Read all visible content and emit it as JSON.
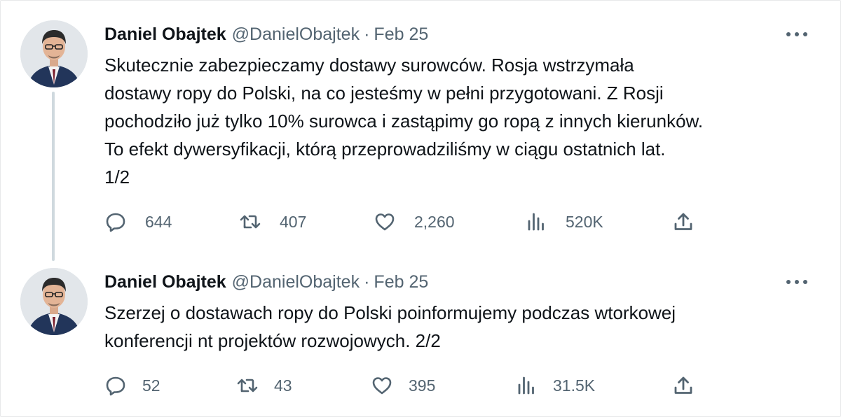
{
  "tweets": [
    {
      "author_name": "Daniel Obajtek",
      "handle": "@DanielObajtek",
      "separator": "·",
      "date": "Feb 25",
      "text_lines": [
        "Skutecznie zabezpieczamy dostawy surowców. Rosja wstrzymała",
        "dostawy ropy do Polski, na co jesteśmy w pełni przygotowani. Z Rosji",
        "pochodziło już tylko 10% surowca i zastąpimy go ropą z innych kierunków.",
        "To efekt dywersyfikacji, którą przeprowadziliśmy w ciągu ostatnich lat.",
        "1/2"
      ],
      "replies": "644",
      "retweets": "407",
      "likes": "2,260",
      "views": "520K"
    },
    {
      "author_name": "Daniel Obajtek",
      "handle": "@DanielObajtek",
      "separator": "·",
      "date": "Feb 25",
      "text_lines": [
        "Szerzej o dostawach ropy do Polski poinformujemy podczas wtorkowej",
        "konferencji nt projektów rozwojowych. 2/2"
      ],
      "replies": "52",
      "retweets": "43",
      "likes": "395",
      "views": "31.5K"
    }
  ],
  "icons": {
    "more": "more-horizontal-icon",
    "reply": "speech-bubble-icon",
    "retweet": "retweet-arrows-icon",
    "like": "heart-icon",
    "views": "bar-chart-icon",
    "share": "upload-share-icon"
  },
  "colors": {
    "text": "#0f1419",
    "secondary": "#536471",
    "thread_line": "#cfd9de",
    "border": "#e7e9ea"
  }
}
